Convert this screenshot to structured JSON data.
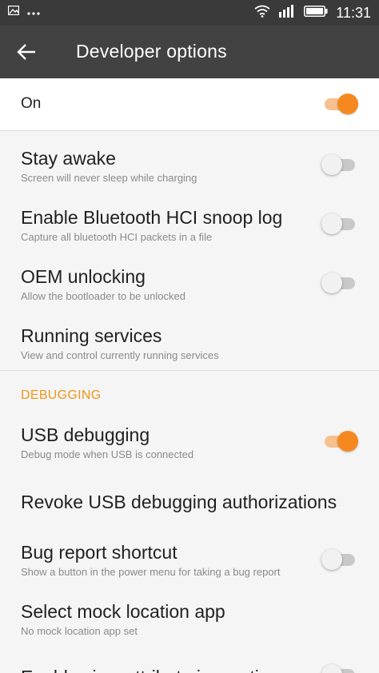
{
  "status_bar": {
    "time": "11:31",
    "left_icons": [
      "image-notification-icon",
      "more-notifications-icon"
    ],
    "right_icons": [
      "wifi-icon",
      "signal-icon",
      "battery-icon"
    ]
  },
  "toolbar": {
    "back_icon": "arrow-left-icon",
    "title": "Developer options"
  },
  "master_switch": {
    "label": "On",
    "checked": true
  },
  "items": [
    {
      "title": "Stay awake",
      "summary": "Screen will never sleep while charging",
      "has_switch": true,
      "checked": false
    },
    {
      "title": "Enable Bluetooth HCI snoop log",
      "summary": "Capture all bluetooth HCI packets in a file",
      "has_switch": true,
      "checked": false
    },
    {
      "title": "OEM unlocking",
      "summary": "Allow the bootloader to be unlocked",
      "has_switch": true,
      "checked": false
    },
    {
      "title": "Running services",
      "summary": "View and control currently running services",
      "has_switch": false
    }
  ],
  "debugging": {
    "header": "DEBUGGING",
    "items": [
      {
        "title": "USB debugging",
        "summary": "Debug mode when USB is connected",
        "has_switch": true,
        "checked": true
      },
      {
        "title": "Revoke USB debugging authorizations",
        "has_switch": false
      },
      {
        "title": "Bug report shortcut",
        "summary": "Show a button in the power menu for taking a bug report",
        "has_switch": true,
        "checked": false
      },
      {
        "title": "Select mock location app",
        "summary": "No mock location app set",
        "has_switch": false
      },
      {
        "title": "Enable view attribute inspection",
        "has_switch": true,
        "checked": false
      }
    ]
  },
  "colors": {
    "accent": "#f5891f",
    "toolbar": "#424242",
    "statusbar": "#3a3a3a"
  }
}
